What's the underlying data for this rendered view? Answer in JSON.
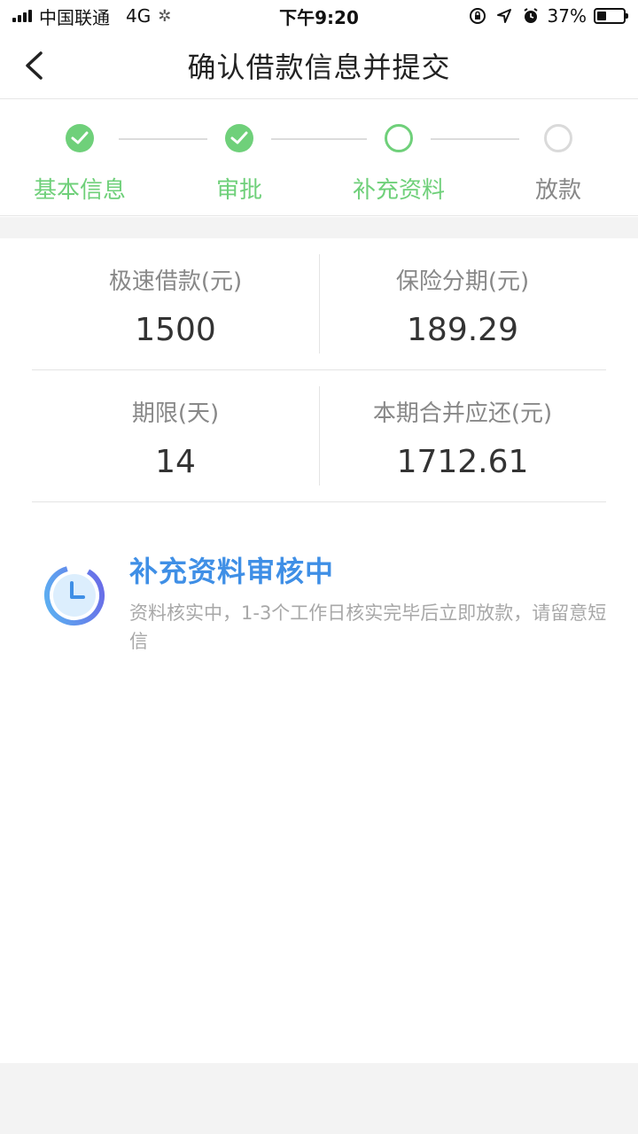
{
  "status_bar": {
    "carrier": "中国联通",
    "network": "4G",
    "time": "下午9:20",
    "battery_percent": "37%",
    "battery_level": 0.37
  },
  "nav": {
    "title": "确认借款信息并提交"
  },
  "steps": [
    {
      "label": "基本信息",
      "state": "done"
    },
    {
      "label": "审批",
      "state": "done"
    },
    {
      "label": "补充资料",
      "state": "current"
    },
    {
      "label": "放款",
      "state": "todo"
    }
  ],
  "info": {
    "loan_amount_label": "极速借款(元)",
    "loan_amount_value": "1500",
    "insurance_label": "保险分期(元)",
    "insurance_value": "189.29",
    "term_label": "期限(天)",
    "term_value": "14",
    "total_label": "本期合并应还(元)",
    "total_value": "1712.61"
  },
  "review": {
    "title": "补充资料审核中",
    "description": "资料核实中，1-3个工作日核实完毕后立即放款，请留意短信"
  },
  "colors": {
    "accent_green": "#6fd07a",
    "accent_blue": "#3f8fe6",
    "inactive_gray": "#dadada"
  }
}
